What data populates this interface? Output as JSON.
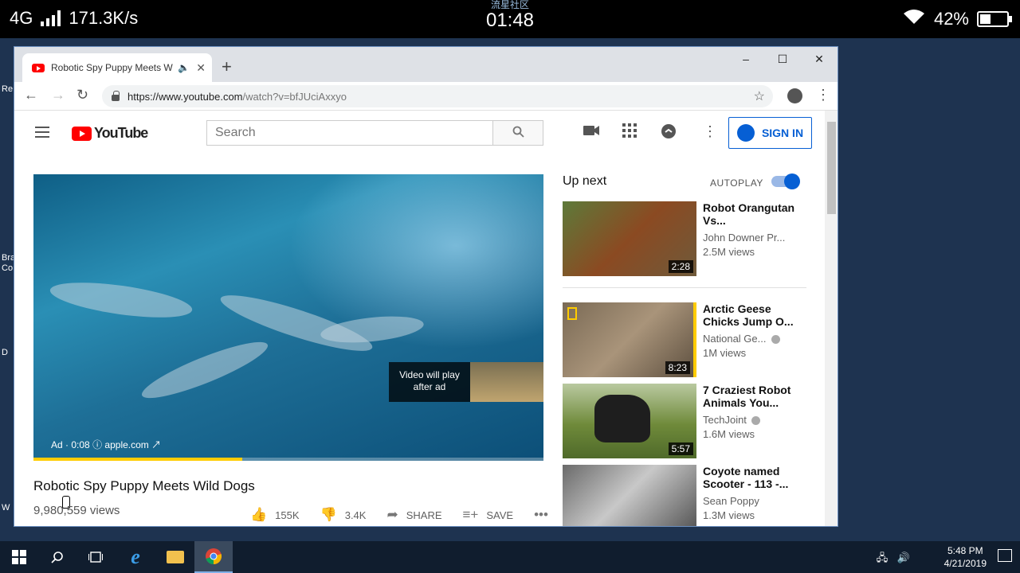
{
  "status_bar": {
    "network": "4G",
    "speed": "171.3K/s",
    "community": "流星社区",
    "time": "01:48",
    "battery": "42%",
    "battery_level": 0.42
  },
  "desktop_fragments": [
    "Re",
    "Bra",
    "Co",
    "D",
    "W"
  ],
  "browser": {
    "tab_title": "Robotic Spy Puppy Meets Wi",
    "new_tab": "+",
    "url_main": "https://www.youtube.com",
    "url_rest": "/watch?v=bfJUciAxxyo",
    "controls": {
      "minimize": "–",
      "maximize": "☐",
      "close": "✕"
    }
  },
  "youtube": {
    "logo_text": "YouTube",
    "search_placeholder": "Search",
    "sign_in": "SIGN IN",
    "player": {
      "preview_text": "Video will play after ad",
      "ad_label": "Ad",
      "ad_time": "0:08",
      "ad_site": "apple.com",
      "progress": 0.41
    },
    "video": {
      "title": "Robotic Spy Puppy Meets Wild Dogs",
      "views": "9,980,559 views",
      "likes": "155K",
      "dislikes": "3.4K",
      "share": "SHARE",
      "save": "SAVE"
    },
    "up_next": "Up next",
    "autoplay": "AUTOPLAY",
    "recommendations": [
      {
        "title": "Robot Orangutan Vs...",
        "channel": "John Downer Pr...",
        "views": "2.5M views",
        "duration": "2:28",
        "verified": false
      },
      {
        "title": "Arctic Geese Chicks Jump O...",
        "channel": "National Ge...",
        "views": "1M views",
        "duration": "8:23",
        "verified": true
      },
      {
        "title": "7 Craziest Robot Animals You...",
        "channel": "TechJoint",
        "views": "1.6M views",
        "duration": "5:57",
        "verified": true
      },
      {
        "title": "Coyote named Scooter - 113 -...",
        "channel": "Sean Poppy",
        "views": "1.3M views",
        "duration": "",
        "verified": false
      }
    ]
  },
  "taskbar": {
    "time": "5:48 PM",
    "date": "4/21/2019"
  },
  "colors": {
    "youtube_red": "#ff0000",
    "link_blue": "#065fd4",
    "ad_progress": "#ffcc00"
  }
}
